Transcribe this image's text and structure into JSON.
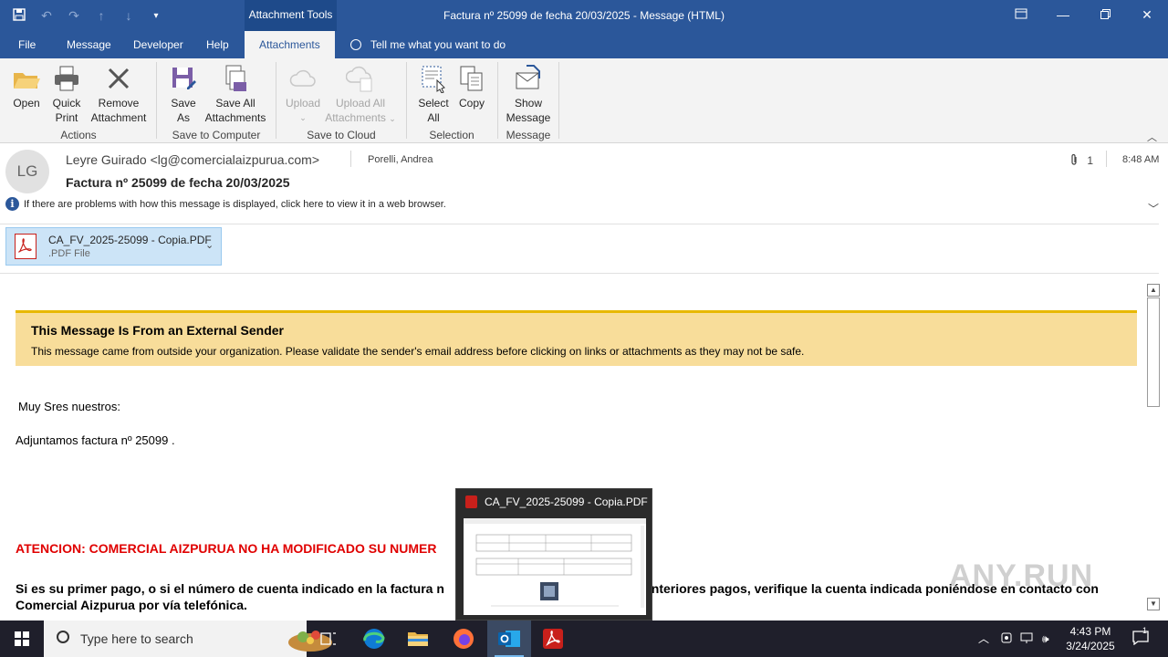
{
  "window": {
    "title": "Factura nº 25099  de fecha 20/03/2025  -  Message (HTML)",
    "context_tools": "Attachment Tools"
  },
  "menu": {
    "items": [
      "File",
      "Message",
      "Developer",
      "Help",
      "Attachments"
    ],
    "tell_me": "Tell me what you want to do"
  },
  "ribbon": {
    "groups": {
      "actions": "Actions",
      "save_computer": "Save to Computer",
      "save_cloud": "Save to Cloud",
      "selection": "Selection",
      "message": "Message"
    },
    "buttons": {
      "open": "Open",
      "quick_print_1": "Quick",
      "quick_print_2": "Print",
      "remove_1": "Remove",
      "remove_2": "Attachment",
      "save_as_1": "Save",
      "save_as_2": "As",
      "save_all_1": "Save All",
      "save_all_2": "Attachments",
      "upload": "Upload",
      "upload_all_1": "Upload All",
      "upload_all_2": "Attachments",
      "select_all_1": "Select",
      "select_all_2": "All",
      "copy": "Copy",
      "show_message_1": "Show",
      "show_message_2": "Message"
    }
  },
  "header": {
    "avatar_initials": "LG",
    "sender": "Leyre Guirado <lg@comercialaizpurua.com>",
    "to": "Porelli, Andrea",
    "attachment_count": "1",
    "time": "8:48 AM",
    "subject": "Factura nº 25099  de fecha 20/03/2025",
    "info": "If there are problems with how this message is displayed, click here to view it in a web browser."
  },
  "attachment": {
    "name": "CA_FV_2025-25099 - Copia.PDF",
    "type": ".PDF File",
    "icon_label": "PDF"
  },
  "body": {
    "banner_title": "This Message Is From an External Sender",
    "banner_text": "This message came from outside your organization. Please validate the sender's email address before clicking on links or attachments as they may not be safe.",
    "greeting": "Muy Sres nuestros:",
    "line1": "Adjuntamos factura nº 25099  .",
    "warning": "ATENCION: COMERCIAL AIZPURUA NO HA MODIFICADO SU NUMER",
    "para_a": "Si es su primer pago, o si el número de cuenta indicado en la factura n",
    "para_b": "anteriores pagos, verifique la cuenta indicada poniéndose en contacto con",
    "para_c": "Comercial Aizpurua por vía telefónica."
  },
  "preview": {
    "title": "CA_FV_2025-25099 - Copia.PDF"
  },
  "watermark": "ANY.RUN",
  "taskbar": {
    "search_placeholder": "Type here to search",
    "time": "4:43 PM",
    "date": "3/24/2025",
    "notification_count": "1"
  },
  "colors": {
    "accent": "#2b579a",
    "banner": "#f8dd9a",
    "warning_red": "#e00000"
  }
}
